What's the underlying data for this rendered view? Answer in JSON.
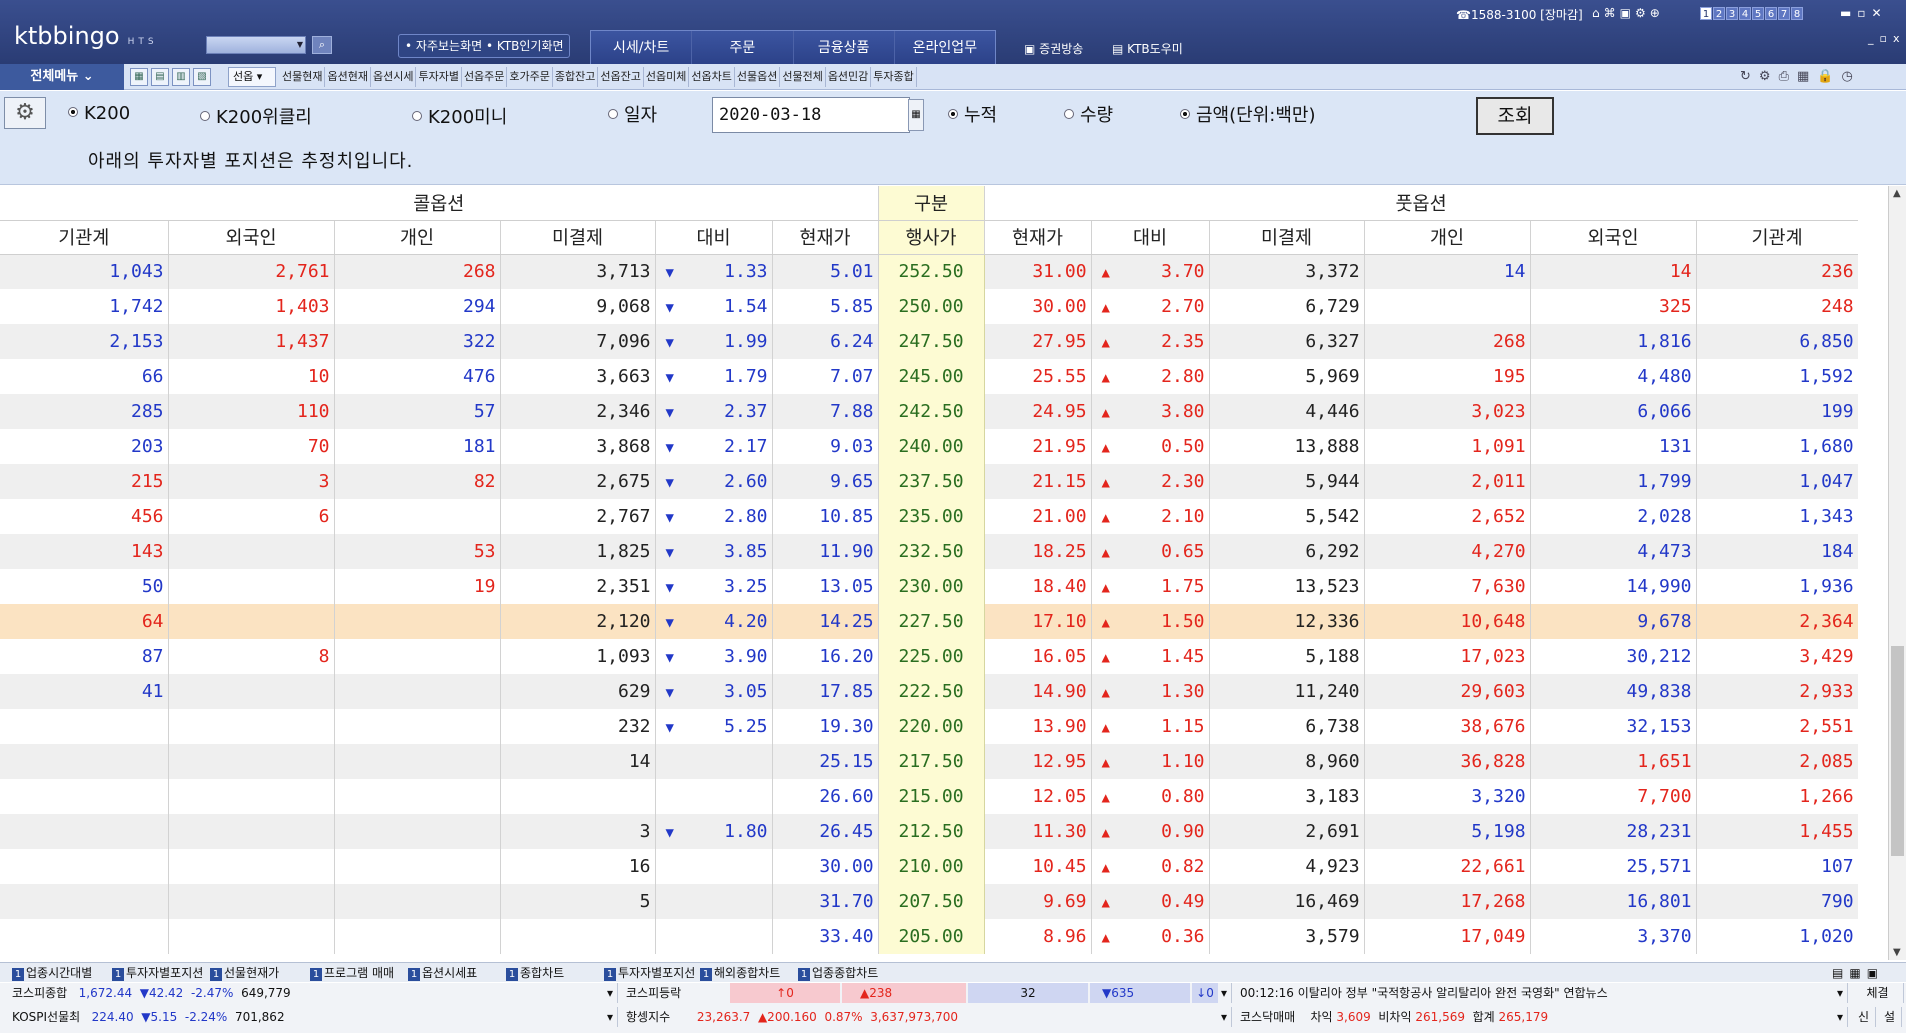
{
  "app": {
    "logo": "ktbbingo",
    "logo_sub": "HTS"
  },
  "top": {
    "quick": [
      "자주보는화면",
      "KTB인기화면"
    ],
    "nav": [
      "시세/차트",
      "주문",
      "금융상품",
      "온라인업무"
    ],
    "tv": "증권방송",
    "helper": "KTB도우미",
    "phone": "1588-3100 [장마감]",
    "screens": [
      "1",
      "2",
      "3",
      "4",
      "5",
      "6",
      "7",
      "8"
    ]
  },
  "menu": {
    "all": "전체메뉴",
    "dropdown": "선옵",
    "items": [
      "선물현재",
      "옵션현재",
      "옵션시세",
      "투자자별",
      "선옵주문",
      "호가주문",
      "종합잔고",
      "선옵잔고",
      "선옵미체",
      "선옵차트",
      "선물옵션",
      "선물전체",
      "옵션민감",
      "투자종합"
    ]
  },
  "filter": {
    "radios1": [
      "K200",
      "K200위클리",
      "K200미니",
      "일자"
    ],
    "date": "2020-03-18",
    "radios2": [
      "누적",
      "수량",
      "금액(단위:백만)"
    ],
    "query": "조회",
    "notice": "아래의 투자자별 포지션은 추정치입니다."
  },
  "table": {
    "group_call": "콜옵션",
    "group_mid": "구분",
    "group_put": "풋옵션",
    "headers": [
      "기관계",
      "외국인",
      "개인",
      "미결제",
      "대비",
      "현재가",
      "행사가",
      "현재가",
      "대비",
      "미결제",
      "개인",
      "외국인",
      "기관계"
    ],
    "rows": [
      [
        "1,043",
        "2,761",
        "268",
        "3,713",
        "1.33",
        "5.01",
        "252.50",
        "31.00",
        "3.70",
        "3,372",
        "14",
        "14",
        "236"
      ],
      [
        "1,742",
        "1,403",
        "294",
        "9,068",
        "1.54",
        "5.85",
        "250.00",
        "30.00",
        "2.70",
        "6,729",
        "",
        "325",
        "248"
      ],
      [
        "2,153",
        "1,437",
        "322",
        "7,096",
        "1.99",
        "6.24",
        "247.50",
        "27.95",
        "2.35",
        "6,327",
        "268",
        "1,816",
        "6,850"
      ],
      [
        "66",
        "10",
        "476",
        "3,663",
        "1.79",
        "7.07",
        "245.00",
        "25.55",
        "2.80",
        "5,969",
        "195",
        "4,480",
        "1,592"
      ],
      [
        "285",
        "110",
        "57",
        "2,346",
        "2.37",
        "7.88",
        "242.50",
        "24.95",
        "3.80",
        "4,446",
        "3,023",
        "6,066",
        "199"
      ],
      [
        "203",
        "70",
        "181",
        "3,868",
        "2.17",
        "9.03",
        "240.00",
        "21.95",
        "0.50",
        "13,888",
        "1,091",
        "131",
        "1,680"
      ],
      [
        "215",
        "3",
        "82",
        "2,675",
        "2.60",
        "9.65",
        "237.50",
        "21.15",
        "2.30",
        "5,944",
        "2,011",
        "1,799",
        "1,047"
      ],
      [
        "456",
        "6",
        "",
        "2,767",
        "2.80",
        "10.85",
        "235.00",
        "21.00",
        "2.10",
        "5,542",
        "2,652",
        "2,028",
        "1,343"
      ],
      [
        "143",
        "",
        "53",
        "1,825",
        "3.85",
        "11.90",
        "232.50",
        "18.25",
        "0.65",
        "6,292",
        "4,270",
        "4,473",
        "184"
      ],
      [
        "50",
        "",
        "19",
        "2,351",
        "3.25",
        "13.05",
        "230.00",
        "18.40",
        "1.75",
        "13,523",
        "7,630",
        "14,990",
        "1,936"
      ],
      [
        "64",
        "",
        "",
        "2,120",
        "4.20",
        "14.25",
        "227.50",
        "17.10",
        "1.50",
        "12,336",
        "10,648",
        "9,678",
        "2,364"
      ],
      [
        "87",
        "8",
        "",
        "1,093",
        "3.90",
        "16.20",
        "225.00",
        "16.05",
        "1.45",
        "5,188",
        "17,023",
        "30,212",
        "3,429"
      ],
      [
        "41",
        "",
        "",
        "629",
        "3.05",
        "17.85",
        "222.50",
        "14.90",
        "1.30",
        "11,240",
        "29,603",
        "49,838",
        "2,933"
      ],
      [
        "",
        "",
        "",
        "232",
        "5.25",
        "19.30",
        "220.00",
        "13.90",
        "1.15",
        "6,738",
        "38,676",
        "32,153",
        "2,551"
      ],
      [
        "",
        "",
        "",
        "14",
        "",
        "25.15",
        "217.50",
        "12.95",
        "1.10",
        "8,960",
        "36,828",
        "1,651",
        "2,085"
      ],
      [
        "",
        "",
        "",
        "",
        "",
        "26.60",
        "215.00",
        "12.05",
        "0.80",
        "3,183",
        "3,320",
        "7,700",
        "1,266"
      ],
      [
        "",
        "",
        "",
        "3",
        "1.80",
        "26.45",
        "212.50",
        "11.30",
        "0.90",
        "2,691",
        "5,198",
        "28,231",
        "1,455"
      ],
      [
        "",
        "",
        "",
        "16",
        "",
        "30.00",
        "210.00",
        "10.45",
        "0.82",
        "4,923",
        "22,661",
        "25,571",
        "107"
      ],
      [
        "",
        "",
        "",
        "5",
        "",
        "31.70",
        "207.50",
        "9.69",
        "0.49",
        "16,469",
        "17,268",
        "16,801",
        "790"
      ],
      [
        "",
        "",
        "",
        "",
        "",
        "33.40",
        "205.00",
        "8.96",
        "0.36",
        "3,579",
        "17,049",
        "3,370",
        "1,020"
      ]
    ],
    "colors": [
      [
        "b",
        "r",
        "r",
        "b",
        "b"
      ],
      [
        "b",
        "r",
        "b",
        "r",
        "b"
      ],
      [
        "b",
        "r",
        "b",
        "r",
        "b"
      ],
      [
        "b",
        "r",
        "b",
        "r",
        "b"
      ],
      [
        "b",
        "b",
        "r",
        "r",
        "b"
      ],
      [
        "b",
        "b",
        "b",
        "r",
        "b"
      ],
      [
        "r",
        "b",
        "b",
        "r",
        "b"
      ],
      [
        "r",
        "b",
        "",
        "r",
        "b"
      ],
      [
        "r",
        "",
        "r",
        "r",
        "b"
      ],
      [
        "b",
        "",
        "r",
        "r",
        "b"
      ],
      [
        "r",
        "",
        "",
        "r",
        "b"
      ],
      [
        "b",
        "r",
        "",
        "r",
        "b"
      ],
      [
        "b",
        "",
        "",
        "r",
        "b"
      ],
      [
        "",
        "",
        "",
        "r",
        "b"
      ],
      [
        "",
        "",
        "",
        "r",
        "r"
      ],
      [
        "",
        "",
        "",
        "b",
        "r"
      ],
      [
        "",
        "",
        "",
        "b",
        "b"
      ],
      [
        "",
        "",
        "",
        "r",
        "b"
      ],
      [
        "",
        "",
        "",
        "r",
        "b"
      ],
      [
        "",
        "",
        "",
        "r",
        "b"
      ]
    ],
    "highlight_row": 10,
    "colors_note_put": "put columns: 개인, 외국인, 기관계 colors listed in last three of each colors row mapping"
  },
  "taskbar": [
    "업종시간대별",
    "투자자별포지션",
    "선물현재가",
    "프로그램 매매",
    "옵션시세표",
    "종합차트",
    "투자자별포지선",
    "해외종합차트",
    "업종종합차트"
  ],
  "status": {
    "kospi": {
      "label": "코스피종합",
      "value": "1,672.44",
      "chg": "▼42.42",
      "pct": "-2.47%",
      "vol": "649,779"
    },
    "kospi_fut": {
      "label": "KOSPI선물최",
      "value": "224.40",
      "chg": "▼5.15",
      "pct": "-2.24%",
      "vol": "701,862"
    },
    "updown": {
      "label": "코스피등락",
      "up_limit": "↑0",
      "up": "▲238",
      "flat": "32",
      "down": "▼635",
      "down_limit": "↓0"
    },
    "hangseng": {
      "label": "항셍지수",
      "value": "23,263.7",
      "chg": "▲200.160",
      "pct": "0.87%",
      "vol": "3,637,973,700"
    },
    "news": "00:12:16  이탈리아 정부 \"국적항공사 알리탈리아 완전 국영화\"  연합뉴스",
    "kosdaq": {
      "label": "코스닥매매",
      "a_label": "차익",
      "a": "3,609",
      "b_label": "비차익",
      "b": "261,569",
      "c_label": "합계",
      "c": "265,179"
    },
    "btn1": "체결",
    "btn2": "신",
    "btn3": "설"
  }
}
